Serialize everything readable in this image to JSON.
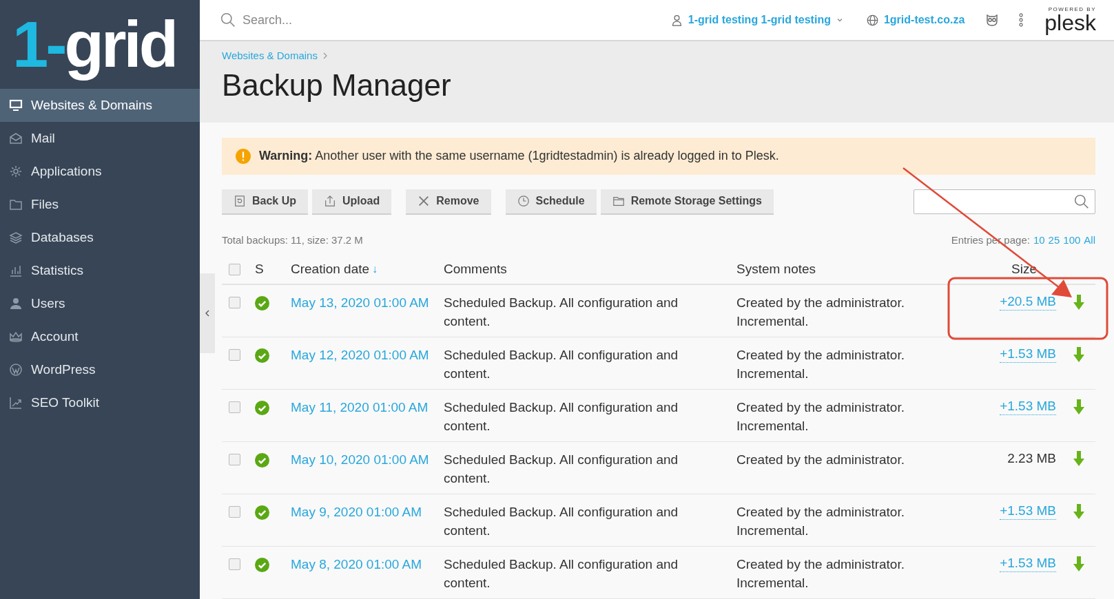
{
  "logo": {
    "accent": "1-",
    "text": "grid"
  },
  "sidebar": {
    "items": [
      {
        "label": "Websites & Domains",
        "selected": true
      },
      {
        "label": "Mail",
        "selected": false
      },
      {
        "label": "Applications",
        "selected": false
      },
      {
        "label": "Files",
        "selected": false
      },
      {
        "label": "Databases",
        "selected": false
      },
      {
        "label": "Statistics",
        "selected": false
      },
      {
        "label": "Users",
        "selected": false
      },
      {
        "label": "Account",
        "selected": false
      },
      {
        "label": "WordPress",
        "selected": false
      },
      {
        "label": "SEO Toolkit",
        "selected": false
      }
    ]
  },
  "topbar": {
    "search": {
      "placeholder": "Search..."
    },
    "user": "1-grid testing 1-grid testing",
    "domain": "1grid-test.co.za",
    "powered_by": "POWERED BY",
    "brand": "plesk"
  },
  "breadcrumb": [
    "Websites & Domains"
  ],
  "title": "Backup Manager",
  "warning": {
    "label": "Warning:",
    "text": "Another user with the same username (1gridtestadmin) is already logged in to Plesk."
  },
  "toolbar": [
    {
      "label": "Back Up"
    },
    {
      "label": "Upload"
    },
    {
      "label": "Remove"
    },
    {
      "label": "Schedule"
    },
    {
      "label": "Remote Storage Settings"
    }
  ],
  "summary": "Total backups: 11, size: 37.2 M",
  "entries_per_page": {
    "label": "Entries per page:",
    "options": [
      "10",
      "25",
      "100",
      "All"
    ]
  },
  "table": {
    "columns": [
      "S",
      "Creation date",
      "Comments",
      "System notes",
      "Size"
    ],
    "sort_marker": "↓",
    "select_all": {
      "checked": false
    },
    "rows": [
      {
        "checked": false,
        "succeeded": true,
        "date": "May 13, 2020 01:00 AM",
        "comment": "Scheduled Backup. All configuration and content.",
        "notes": "Created by the administrator. Incremental.",
        "size": "+20.5 MB",
        "size_is_link": true
      },
      {
        "checked": false,
        "succeeded": true,
        "date": "May 12, 2020 01:00 AM",
        "comment": "Scheduled Backup. All configuration and content.",
        "notes": "Created by the administrator. Incremental.",
        "size": "+1.53 MB",
        "size_is_link": true
      },
      {
        "checked": false,
        "succeeded": true,
        "date": "May 11, 2020 01:00 AM",
        "comment": "Scheduled Backup. All configuration and content.",
        "notes": "Created by the administrator. Incremental.",
        "size": "+1.53 MB",
        "size_is_link": true
      },
      {
        "checked": false,
        "succeeded": true,
        "date": "May 10, 2020 01:00 AM",
        "comment": "Scheduled Backup. All configuration and content.",
        "notes": "Created by the administrator.",
        "size": "2.23 MB",
        "size_is_link": false
      },
      {
        "checked": false,
        "succeeded": true,
        "date": "May 9, 2020 01:00 AM",
        "comment": "Scheduled Backup. All configuration and content.",
        "notes": "Created by the administrator. Incremental.",
        "size": "+1.53 MB",
        "size_is_link": true
      },
      {
        "checked": false,
        "succeeded": true,
        "date": "May 8, 2020 01:00 AM",
        "comment": "Scheduled Backup. All configuration and content.",
        "notes": "Created by the administrator. Incremental.",
        "size": "+1.53 MB",
        "size_is_link": true
      }
    ]
  }
}
